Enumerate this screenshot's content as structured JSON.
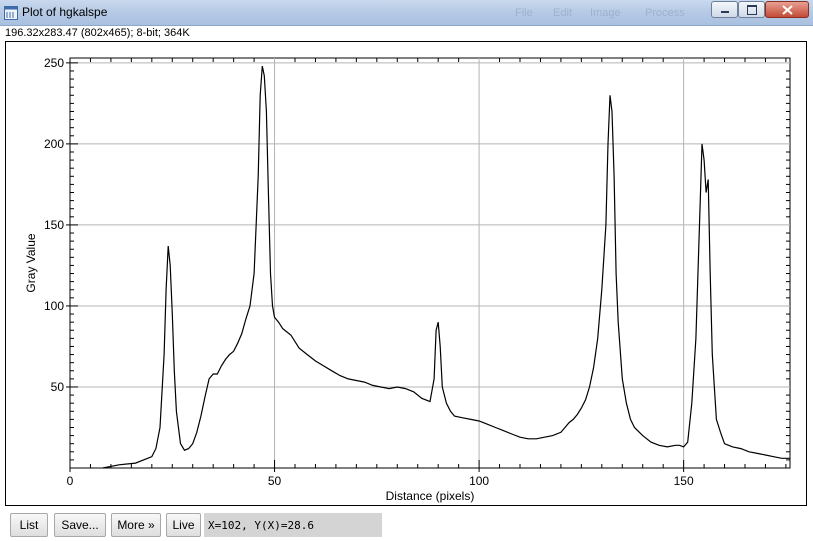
{
  "window": {
    "title": "Plot of hgkalspe",
    "ghost_menu": [
      "File",
      "Edit",
      "Image",
      "Process"
    ]
  },
  "info_line": "196.32x283.47    (802x465); 8-bit; 364K",
  "buttons": {
    "list": "List",
    "save": "Save...",
    "more": "More »",
    "live": "Live"
  },
  "coordinates_readout": "X=102, Y(X)=28.6",
  "colors": {
    "plot_line": "#000000",
    "grid": "#b4b4b4",
    "titlebar": "#b7cbe6",
    "close_button": "#c24b36"
  },
  "chart_data": {
    "type": "line",
    "title": "",
    "xlabel": "Distance (pixels)",
    "ylabel": "Gray Value",
    "xlim": [
      0,
      176
    ],
    "ylim": [
      0,
      253
    ],
    "xticks": [
      0,
      50,
      100,
      150
    ],
    "yticks": [
      50,
      100,
      150,
      200,
      250
    ],
    "grid": true,
    "x": [
      8,
      12,
      16,
      20,
      21,
      22,
      23,
      23.5,
      24,
      24.5,
      25,
      25.5,
      26,
      27,
      28,
      29,
      30,
      31,
      32,
      33,
      34,
      35,
      36,
      37,
      38,
      39,
      40,
      41,
      42,
      43,
      44,
      45,
      46,
      46.5,
      47,
      47.5,
      48,
      48.5,
      49,
      49.5,
      50,
      51,
      52,
      53,
      54,
      55,
      56,
      58,
      60,
      62,
      64,
      66,
      68,
      70,
      72,
      74,
      76,
      78,
      80,
      82,
      84,
      86,
      88,
      89,
      89.5,
      90,
      90.5,
      91,
      92,
      93,
      94,
      96,
      98,
      100,
      102,
      104,
      106,
      108,
      110,
      112,
      114,
      116,
      118,
      120,
      121,
      122,
      123,
      124,
      125,
      126,
      127,
      128,
      129,
      130,
      131,
      131.5,
      132,
      132.5,
      133,
      133.5,
      134,
      135,
      136,
      137,
      138,
      140,
      142,
      144,
      146,
      148,
      149,
      150,
      151,
      152,
      153,
      154,
      154.5,
      155,
      155.5,
      156,
      156.5,
      157,
      158,
      159,
      160,
      162,
      164,
      166,
      168,
      170,
      172,
      174,
      176
    ],
    "y": [
      0,
      2,
      3,
      7,
      12,
      25,
      70,
      110,
      137,
      125,
      95,
      60,
      35,
      15,
      11,
      12,
      15,
      22,
      32,
      44,
      55,
      58,
      58,
      63,
      67,
      70,
      72,
      77,
      83,
      92,
      100,
      120,
      180,
      230,
      248,
      242,
      220,
      170,
      120,
      100,
      93,
      90,
      86,
      84,
      82,
      78,
      74,
      70,
      66,
      63,
      60,
      57,
      55,
      54,
      53,
      51,
      50,
      49,
      50,
      49,
      47,
      43,
      41,
      55,
      85,
      90,
      75,
      50,
      40,
      35,
      32,
      31,
      30,
      29,
      27,
      25,
      23,
      21,
      19,
      18,
      18,
      19,
      20,
      22,
      25,
      28,
      30,
      33,
      37,
      42,
      50,
      62,
      80,
      110,
      150,
      200,
      230,
      220,
      180,
      120,
      90,
      55,
      40,
      30,
      25,
      20,
      16,
      14,
      13,
      14,
      14,
      13,
      16,
      40,
      80,
      160,
      200,
      190,
      170,
      178,
      120,
      70,
      30,
      22,
      15,
      13,
      12,
      10,
      9,
      8,
      7,
      6,
      6
    ]
  }
}
